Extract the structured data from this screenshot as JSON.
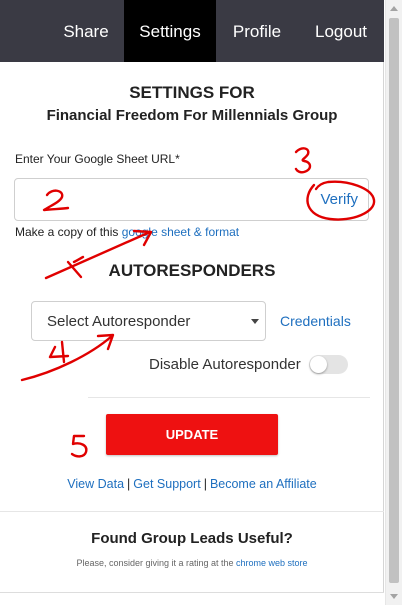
{
  "nav": {
    "items": [
      {
        "label": "Share"
      },
      {
        "label": "Settings",
        "active": true
      },
      {
        "label": "Profile"
      },
      {
        "label": "Logout"
      }
    ]
  },
  "header": {
    "title": "SETTINGS FOR",
    "group": "Financial Freedom For Millennials Group"
  },
  "sheet": {
    "label": "Enter Your Google Sheet URL*",
    "value": "",
    "verify": "Verify",
    "copy_prefix": "Make a copy of this ",
    "copy_link": "google sheet & format"
  },
  "autoresponders": {
    "title": "AUTORESPONDERS",
    "select_value": "Select Autoresponder",
    "credentials": "Credentials",
    "disable_label": "Disable Autoresponder",
    "disabled": false
  },
  "update_label": "UPDATE",
  "links": {
    "view_data": "View Data",
    "sep": "|",
    "support": "Get Support",
    "affiliate": "Become an Affiliate"
  },
  "footer": {
    "title": "Found Group Leads Useful?",
    "rate_prefix": "Please, consider giving it a rating at the ",
    "rate_link": "chrome web store"
  },
  "colors": {
    "nav_bg": "#3a3a44",
    "nav_active": "#000000",
    "link": "#1e6fbf",
    "update_button": "#ee1111",
    "annotation": "#e00000"
  }
}
